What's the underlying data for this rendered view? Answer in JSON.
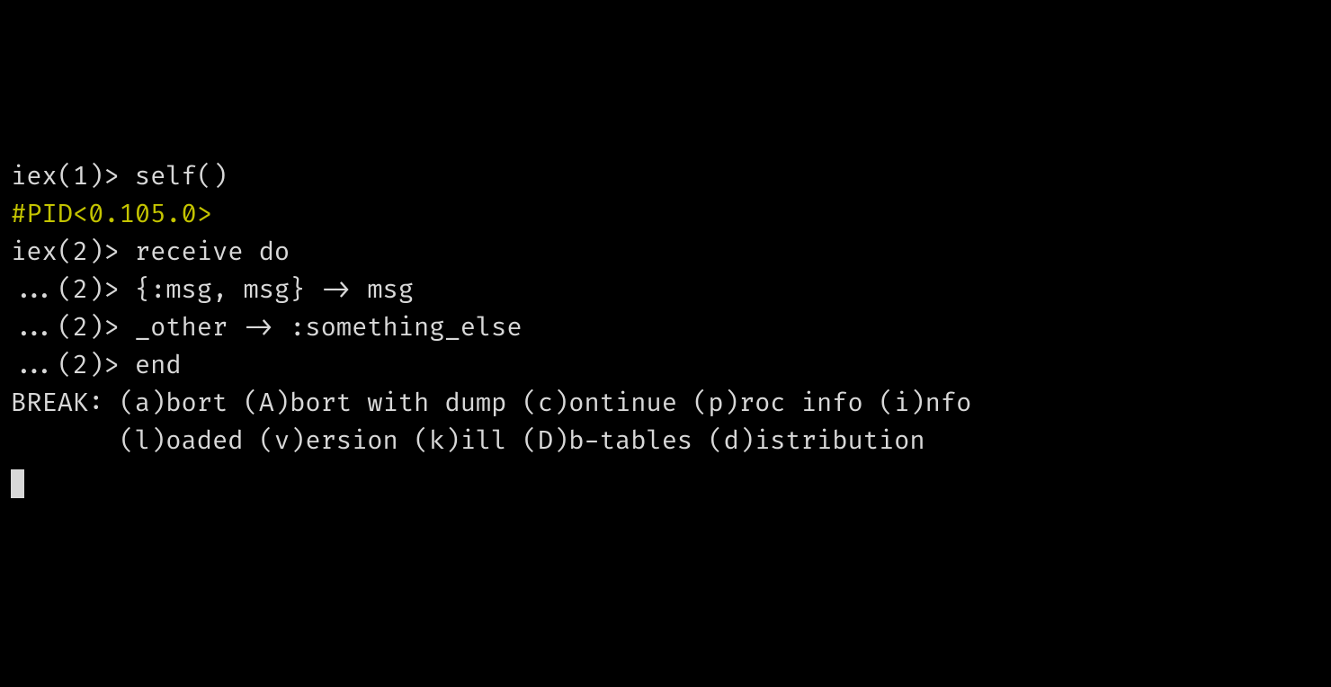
{
  "terminal": {
    "lines": [
      {
        "prompt": "iex(1)> ",
        "input": "self()",
        "type": "prompt"
      },
      {
        "output": "#PID<0.105.0>",
        "type": "pid"
      },
      {
        "prompt": "iex(2)> ",
        "input": "receive do",
        "type": "prompt"
      },
      {
        "prompt": "...(2)> ",
        "input": "{:msg, msg} -> msg",
        "type": "continuation"
      },
      {
        "prompt": "...(2)> ",
        "input": "_other -> :something_else",
        "type": "continuation"
      },
      {
        "prompt": "...(2)> ",
        "input": "end",
        "type": "continuation"
      },
      {
        "output": "",
        "type": "blank"
      },
      {
        "output": "BREAK: (a)bort (A)bort with dump (c)ontinue (p)roc info (i)nfo",
        "type": "break"
      },
      {
        "output": "       (l)oaded (v)ersion (k)ill (D)b-tables (d)istribution",
        "type": "break"
      }
    ],
    "line0_prompt": "iex(1)> ",
    "line0_input": "self()",
    "line1_output": "#PID<0.105.0>",
    "line2_prompt": "iex(2)> ",
    "line2_input": "receive do",
    "line3_prompt": "...(2)> ",
    "line3_input": "{:msg, msg} -> msg",
    "line4_prompt": "...(2)> ",
    "line4_input": "_other -> :something_else",
    "line5_prompt": "...(2)> ",
    "line5_input": "end",
    "line6_output": "",
    "line7_output": "BREAK: (a)bort (A)bort with dump (c)ontinue (p)roc info (i)nfo",
    "line8_output": "       (l)oaded (v)ersion (k)ill (D)b-tables (d)istribution"
  },
  "colors": {
    "background": "#000000",
    "foreground": "#d8d8d8",
    "pid": "#c4c400"
  }
}
